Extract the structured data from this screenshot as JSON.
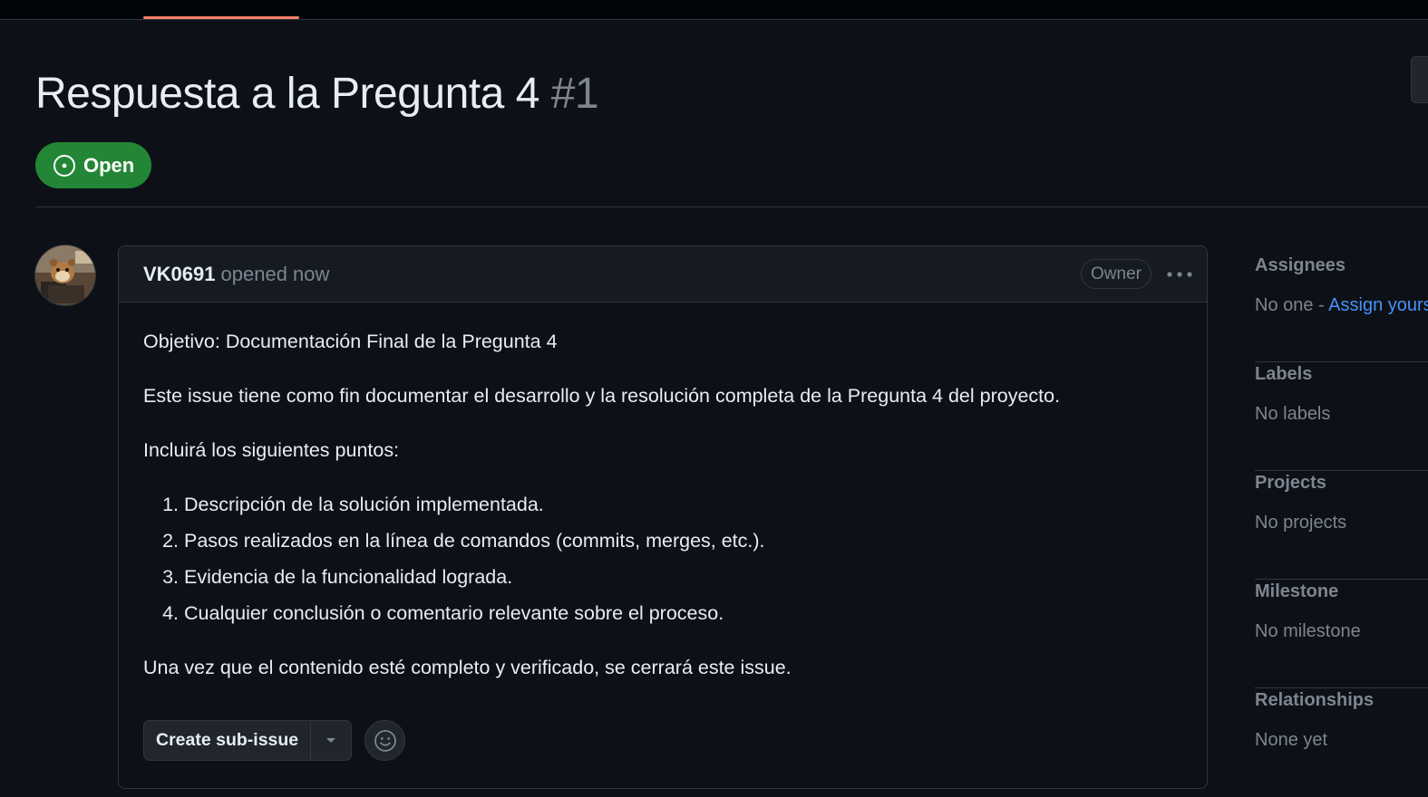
{
  "issue": {
    "title": "Respuesta a la Pregunta 4",
    "number": "#1",
    "state": "Open",
    "state_color": "#238636"
  },
  "comment": {
    "author": "VK0691",
    "meta": "opened now",
    "role_badge": "Owner",
    "body": {
      "objective": "Objetivo: Documentación Final de la Pregunta 4",
      "intro": "Este issue tiene como fin documentar el desarrollo y la resolución completa de la Pregunta 4 del proyecto.",
      "list_intro": "Incluirá los siguientes puntos:",
      "points": [
        "Descripción de la solución implementada.",
        "Pasos realizados en la línea de comandos (commits, merges, etc.).",
        "Evidencia de la funcionalidad lograda.",
        "Cualquier conclusión o comentario relevante sobre el proceso."
      ],
      "closing": "Una vez que el contenido esté completo y verificado, se cerrará este issue."
    },
    "actions": {
      "create_sub_issue": "Create sub-issue"
    }
  },
  "sidebar": {
    "assignees": {
      "heading": "Assignees",
      "value": "No one - ",
      "link": "Assign yourself"
    },
    "labels": {
      "heading": "Labels",
      "value": "No labels"
    },
    "projects": {
      "heading": "Projects",
      "value": "No projects"
    },
    "milestone": {
      "heading": "Milestone",
      "value": "No milestone"
    },
    "relationships": {
      "heading": "Relationships",
      "value": "None yet"
    }
  },
  "colors": {
    "background": "#0d1117",
    "border": "#30363d",
    "accent_link": "#4493f8",
    "tab_underline": "#f78166"
  }
}
